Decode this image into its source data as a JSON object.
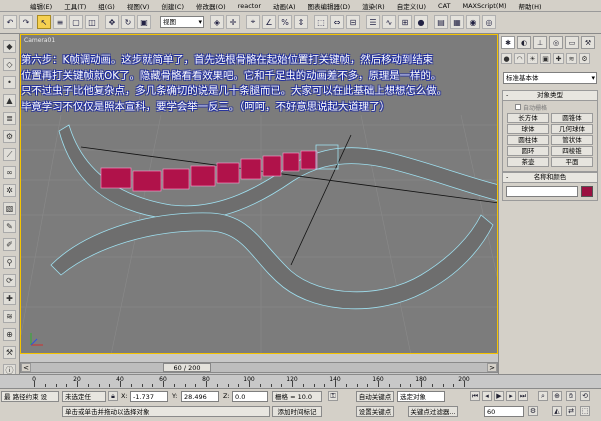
{
  "menu": [
    "编辑(E)",
    "工具(T)",
    "组(G)",
    "视图(V)",
    "创建(C)",
    "修改器(O)",
    "reactor",
    "动画(A)",
    "图表编辑器(D)",
    "渲染(R)",
    "自定义(U)",
    "CAT",
    "MAXScript(M)",
    "帮助(H)"
  ],
  "toolbar": {
    "view_dropdown": "视图"
  },
  "viewport": {
    "label": "Camera01",
    "overlay_lines": [
      "第六步：K帧调动画。这步就简单了，首先选根骨骼在起始位置打关键帧，然后移动到结束",
      "位置再打关键帧就OK了。隐藏骨骼看看效果吧。它和千足虫的动画差不多，原理是一样的。",
      "只不过虫子比他复杂点，多几条确切的说是几十条腿而已。大家可以在此基础上想想怎么做。",
      "毕竟学习不仅仅是照本宣科，要学会举一反三。（呵呵，不好意思说起大道理了）"
    ]
  },
  "command_panel": {
    "category_dropdown": "标准基本体",
    "object_type": {
      "title": "对象类型",
      "autogrid": "自动栅格",
      "buttons": [
        "长方体",
        "圆锥体",
        "球体",
        "几何球体",
        "圆柱体",
        "管状体",
        "圆环",
        "四棱锥",
        "茶壶",
        "平面"
      ]
    },
    "name_color": {
      "title": "名称和颜色",
      "color": "#9a1040"
    }
  },
  "time_slider": {
    "label": "60 / 200"
  },
  "trackbar": {
    "ticks": [
      "0",
      "20",
      "40",
      "60",
      "80",
      "100",
      "120",
      "140",
      "160",
      "180",
      "200"
    ]
  },
  "status": {
    "maxscript": "最 路径约束 设",
    "selection": "未选定任",
    "x_label": "X:",
    "x_value": "-1.737",
    "y_label": "Y:",
    "y_value": "28.496",
    "z_label": "Z:",
    "z_value": "0.0",
    "grid": "栅格 = 10.0",
    "prompt": "单击或单击并拖动以选择对象",
    "add_time_tag": "添加时间标记",
    "auto_key": "自动关键点",
    "set_key": "设置关键点",
    "selected_dropdown": "选定对象",
    "key_filters": "关键点过滤器...",
    "frame": "60"
  }
}
